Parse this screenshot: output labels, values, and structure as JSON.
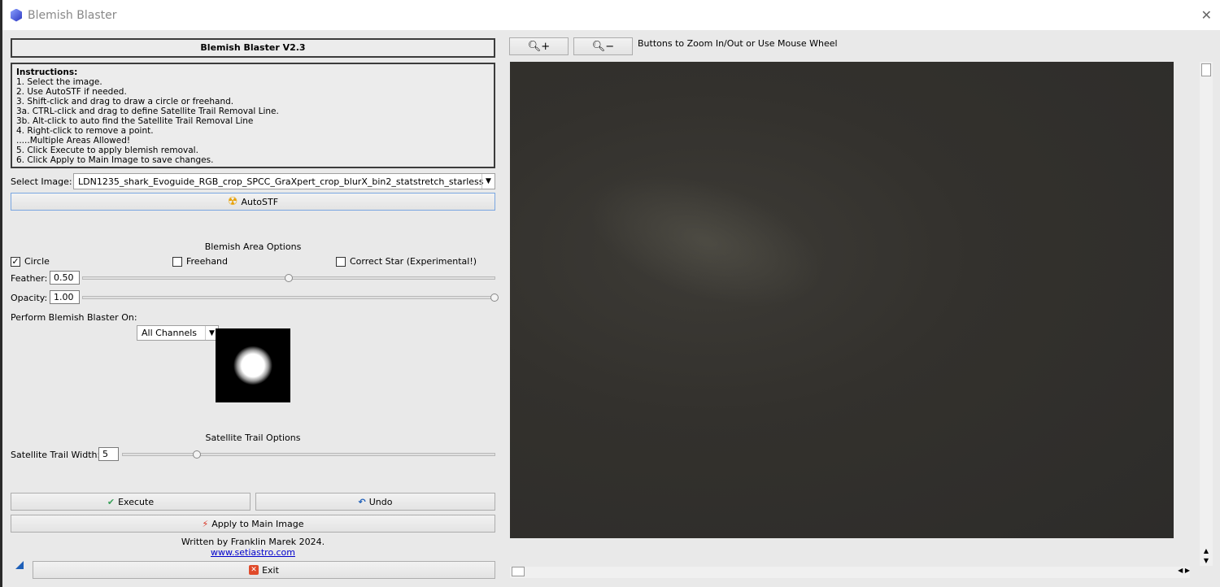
{
  "window": {
    "title": "Blemish Blaster",
    "close": "✕"
  },
  "panel": {
    "header": "Blemish Blaster V2.3",
    "instructions": [
      "Instructions:",
      "1. Select the image.",
      "2. Use AutoSTF if needed.",
      "3. Shift-click and drag to draw a circle or freehand.",
      "3a. CTRL-click and drag to define Satellite Trail Removal Line.",
      "3b. Alt-click to auto find the Satellite Trail Removal Line",
      "4. Right-click to remove a point.",
      ".....Multiple Areas Allowed!",
      "5. Click Execute to apply blemish removal.",
      "6. Click Apply to Main Image to save changes."
    ],
    "select_image_label": "Select Image:",
    "select_image_value": "LDN1235_shark_Evoguide_RGB_crop_SPCC_GraXpert_crop_blurX_bin2_statstretch_starless",
    "autostf": "AutoSTF",
    "blemish_section": "Blemish Area Options",
    "circle": {
      "label": "Circle",
      "checked": true
    },
    "freehand": {
      "label": "Freehand",
      "checked": false
    },
    "correct_star": {
      "label": "Correct Star (Experimental!)",
      "checked": false
    },
    "feather_label": "Feather:",
    "feather_value": "0.50",
    "feather_fraction": 0.5,
    "opacity_label": "Opacity:",
    "opacity_value": "1.00",
    "opacity_fraction": 1.0,
    "perform_label": "Perform Blemish Blaster On:",
    "perform_value": "All Channels",
    "satellite_section": "Satellite Trail Options",
    "trail_width_label": "Satellite Trail Width:",
    "trail_width_value": "5",
    "trail_width_fraction": 0.2,
    "execute": "Execute",
    "undo": "Undo",
    "apply": "Apply to Main Image",
    "credit": "Written by Franklin Marek 2024.",
    "link": "www.setiastro.com",
    "exit": "Exit"
  },
  "viewer": {
    "zoom_hint": "Buttons to Zoom In/Out or Use Mouse Wheel",
    "zoom_in_icon": "zoom-in-icon",
    "zoom_out_icon": "zoom-out-icon"
  },
  "colors": {
    "check": "#3aa05a",
    "undo": "#1e5fb8",
    "bolt": "#d83020",
    "exit": "#e04a2a"
  }
}
